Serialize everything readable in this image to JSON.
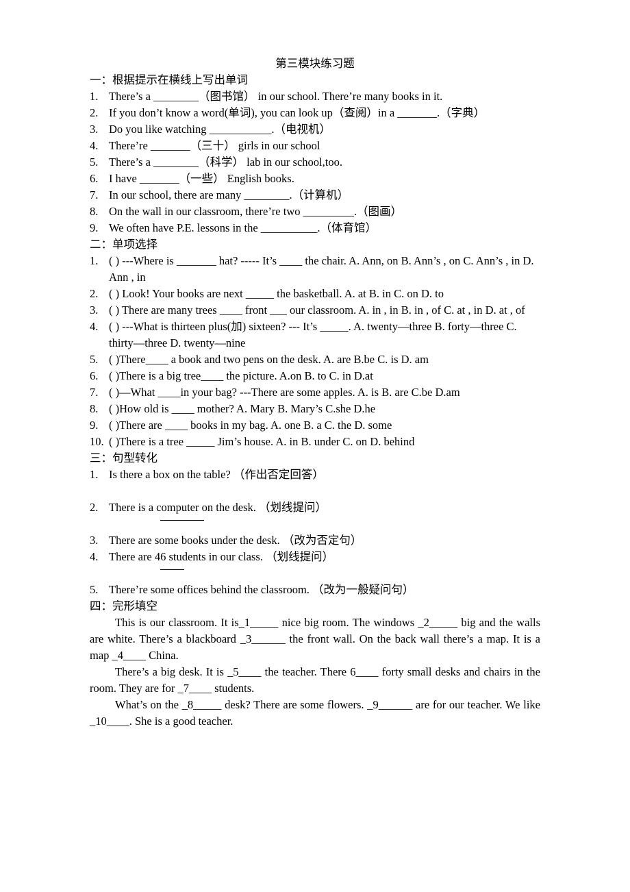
{
  "title": "第三模块练习题",
  "part1": {
    "heading": "一：根据提示在横线上写出单词",
    "items": [
      {
        "num": "1.",
        "text": "There’s a ________（图书馆） in our school. There’re many books in it."
      },
      {
        "num": "2.",
        "text": "If you don’t know a word(单词), you can look up（查阅）in a _______.（字典）"
      },
      {
        "num": "3.",
        "text": "Do you like watching ___________.（电视机）"
      },
      {
        "num": "4.",
        "text": "There’re _______（三十） girls in our school"
      },
      {
        "num": "5.",
        "text": "There’s a ________（科学） lab in our school,too."
      },
      {
        "num": "6.",
        "text": "I have _______（一些） English books."
      },
      {
        "num": "7.",
        "text": "In our school, there are many ________.（计算机）"
      },
      {
        "num": "8.",
        "text": "On the wall in our classroom, there’re two _________.（图画）"
      },
      {
        "num": "9.",
        "text": "We often have P.E. lessons in the __________.（体育馆）"
      }
    ]
  },
  "part2": {
    "heading": "二：单项选择",
    "items": [
      {
        "num": "1.",
        "text": "(    ) ---Where is _______ hat? ----- It’s ____ the chair. A. Ann, on    B. Ann’s , on C. Ann’s , in    D. Ann , in"
      },
      {
        "num": "2.",
        "text": "(    ) Look! Your books are next _____ the basketball. A. at    B. in    C. on    D. to"
      },
      {
        "num": "3.",
        "text": "(    ) There are many trees ____ front ___ our classroom.    A. in , in    B. in , of    C. at , in     D. at , of"
      },
      {
        "num": "4.",
        "text": "(    ) ---What is thirteen plus(加) sixteen? --- It’s _____.      A. twenty—three    B. forty—three     C. thirty—three     D. twenty—nine"
      },
      {
        "num": "5.",
        "text": "(    )There____ a book and two pens on the desk.    A. are    B.be    C. is    D. am"
      },
      {
        "num": "6.",
        "text": "(    )There is a big tree____ the picture.    A.on    B. to    C. in     D.at"
      },
      {
        "num": "7.",
        "text": "(    )—What ____in your bag? ---There are some apples. A. is B. are C.be     D.am"
      },
      {
        "num": "8.",
        "text": "(    )How old is ____ mother? A. Mary B. Mary’s    C.she    D.he"
      },
      {
        "num": "9.",
        "text": "(    )There are ____ books in my bag.    A. one    B. a    C. the    D. some"
      },
      {
        "num": "10.",
        "text": "(    )There is a tree _____ Jim’s house.    A. in    B. under    C. on    D. behind"
      }
    ]
  },
  "part3": {
    "heading": "三：句型转化",
    "items": [
      {
        "num": "1.",
        "text": "Is there a box on the table? （作出否定回答）"
      },
      {
        "num": "2.",
        "text": "There is a computer on the desk. （划线提问）"
      },
      {
        "num": "3.",
        "text": "There are some books under the desk. （改为否定句）"
      },
      {
        "num": "4.",
        "text": "There are 46 students in our class. （划线提问）"
      },
      {
        "num": "5.",
        "text": "There’re some offices behind the classroom. （改为一般疑问句）"
      }
    ]
  },
  "part4": {
    "heading": "四：完形填空",
    "paragraphs": [
      "This is our classroom. It is_1_____ nice big room. The windows _2_____ big and the walls are white. There’s a blackboard _3______ the front wall. On the back wall there’s a map. It is a map _4____ China.",
      "There’s a big desk. It is _5____ the teacher. There 6____ forty small desks and chairs in the room. They are for _7____ students.",
      "What’s on the _8_____ desk? There are some flowers. _9______ are for our teacher. We like _10____. She is a good teacher."
    ]
  }
}
